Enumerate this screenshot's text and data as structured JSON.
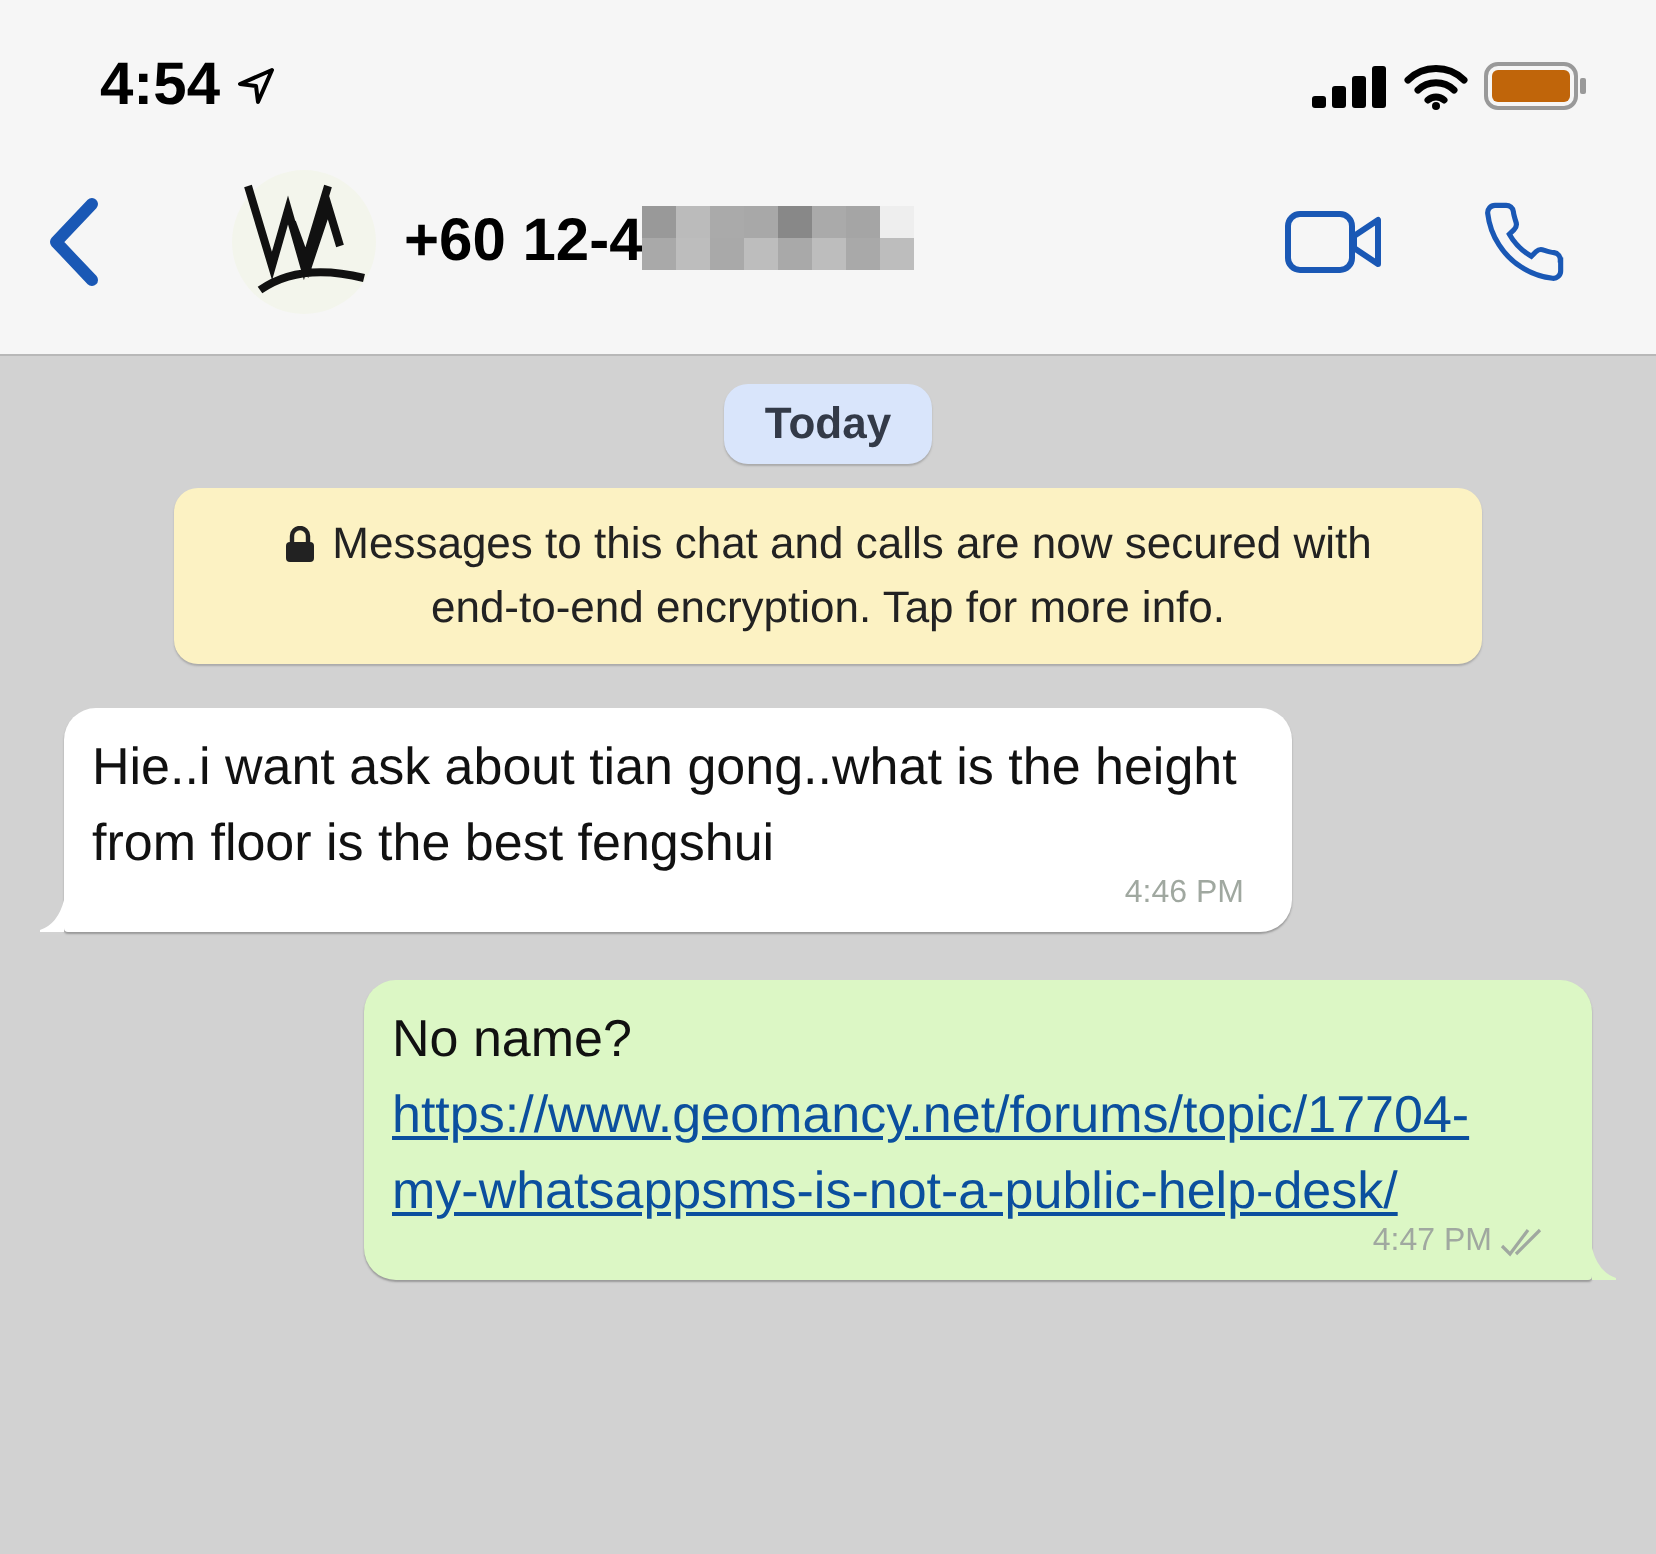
{
  "status_bar": {
    "time": "4:54"
  },
  "header": {
    "contact": "+60 12-4"
  },
  "date_chip": "Today",
  "encryption_notice": "Messages to this chat and calls are now secured with end-to-end encryption. Tap for more info.",
  "messages": [
    {
      "kind": "incoming",
      "text": "Hie..i want ask about tian gong..what is the height from floor is the best fengshui",
      "time": "4:46 PM"
    },
    {
      "kind": "outgoing",
      "text": "No name?",
      "link": "https://www.geomancy.net/forums/topic/17704-my-whatsappsms-is-not-a-public-help-desk/",
      "time": "4:47 PM",
      "read": false
    }
  ]
}
